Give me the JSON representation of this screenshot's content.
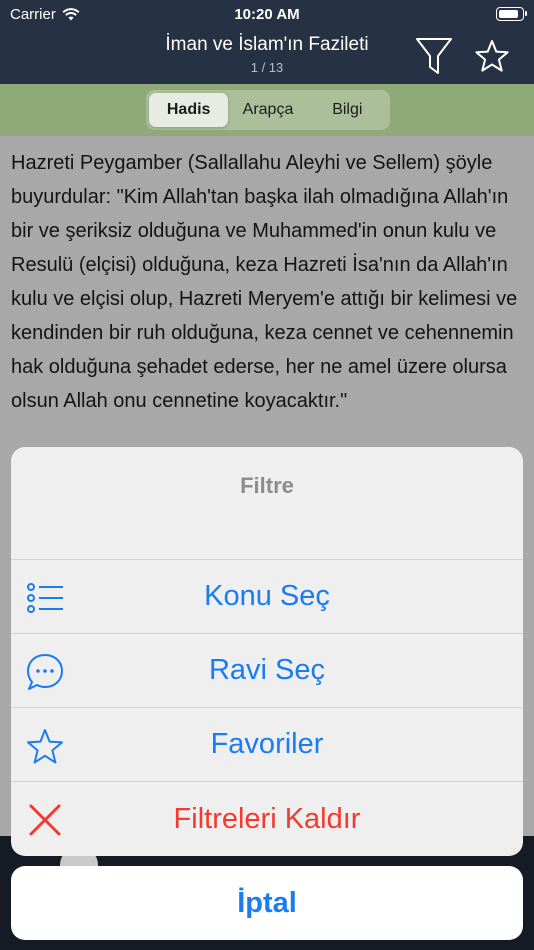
{
  "status_bar": {
    "carrier": "Carrier",
    "time": "10:20 AM",
    "battery_level": 0.85
  },
  "navbar": {
    "title": "İman ve İslam'ın Fazileti",
    "subtitle": "1 / 13"
  },
  "segments": [
    {
      "label": "Hadis",
      "selected": true
    },
    {
      "label": "Arapça",
      "selected": false
    },
    {
      "label": "Bilgi",
      "selected": false
    }
  ],
  "hadis": {
    "text": "Hazreti Peygamber (Sallallahu Aleyhi ve Sellem) şöyle buyurdular: \"Kim Allah'tan başka ilah olmadığına Allah'ın bir ve şeriksiz olduğuna ve Muhammed'in onun kulu ve Resulü (elçisi) olduğuna, keza Hazreti İsa'nın da Allah'ın kulu ve elçisi olup, Hazreti Meryem'e attığı bir kelimesi ve kendinden bir ruh olduğuna, keza cennet ve cehennemin hak olduğuna şehadet ederse, her ne amel üzere olursa olsun Allah onu cennetine koyacaktır.\""
  },
  "action_sheet": {
    "title": "Filtre",
    "actions": [
      {
        "label": "Konu Seç",
        "icon": "list-icon"
      },
      {
        "label": "Ravi Seç",
        "icon": "chat-bubble-icon"
      },
      {
        "label": "Favoriler",
        "icon": "star-outline-icon"
      },
      {
        "label": "Filtreleri Kaldır",
        "icon": "close-x-icon"
      }
    ],
    "cancel_label": "İptal"
  },
  "colors": {
    "navbar": "#263144",
    "segment_bar": "#8faa78",
    "action_blue": "#1a7cf0",
    "destructive_red": "#f23b30"
  }
}
